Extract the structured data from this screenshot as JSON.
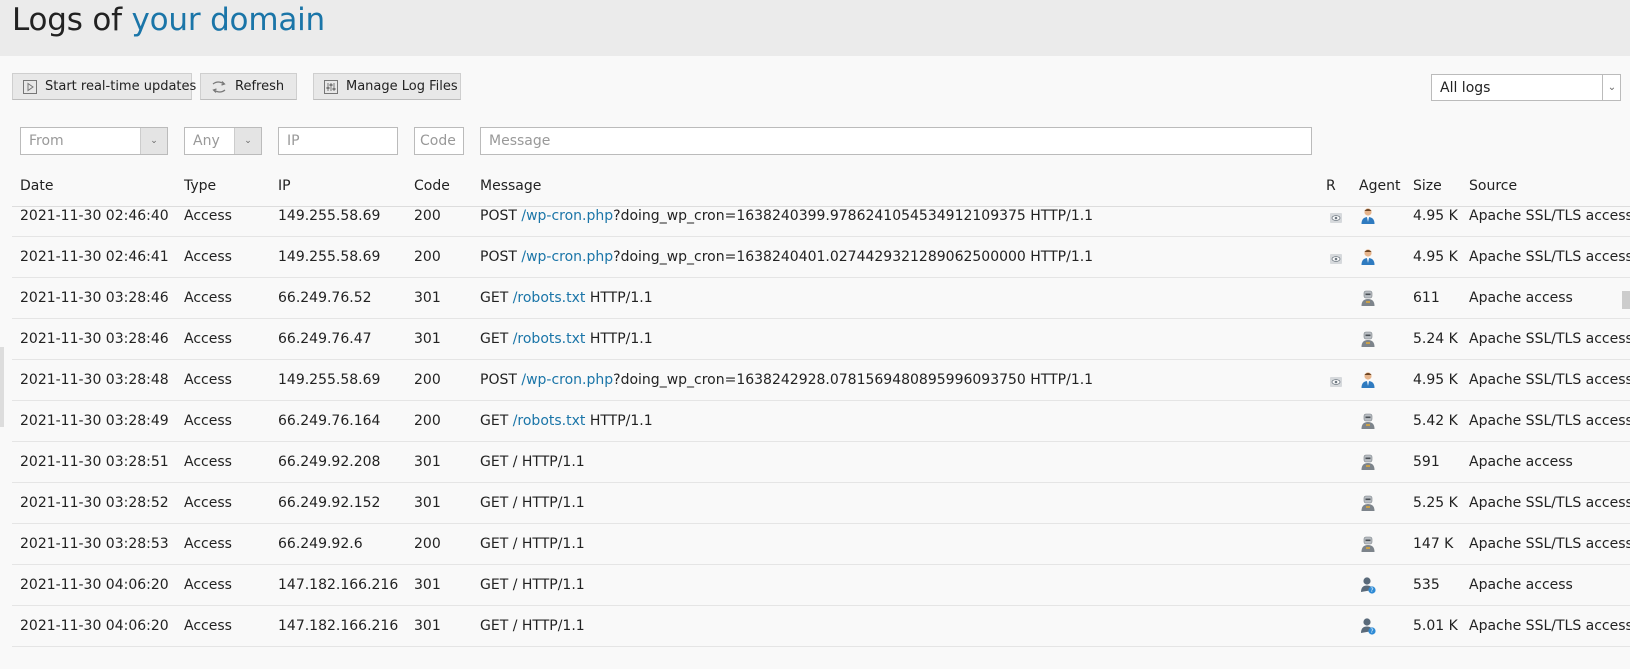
{
  "title": {
    "prefix": "Logs of",
    "domain": "your domain"
  },
  "toolbar": {
    "realtime_label": "Start real-time updates",
    "refresh_label": "Refresh",
    "manage_label": "Manage Log Files"
  },
  "log_select": {
    "value": "All logs"
  },
  "filters": {
    "from_placeholder": "From",
    "type_placeholder": "Any",
    "ip_placeholder": "IP",
    "code_placeholder": "Code",
    "message_placeholder": "Message"
  },
  "columns": {
    "date": "Date",
    "type": "Type",
    "ip": "IP",
    "code": "Code",
    "message": "Message",
    "r": "R",
    "agent": "Agent",
    "size": "Size",
    "source": "Source"
  },
  "rows": [
    {
      "date": "2021-11-30 02:46:40",
      "type": "Access",
      "ip": "149.255.58.69",
      "code": "200",
      "method": "POST",
      "path": "/wp-cron.php",
      "rest": "?doing_wp_cron=1638240399.9786241054534912109375 HTTP/1.1",
      "r": true,
      "agent": "user",
      "size": "4.95 K",
      "source": "Apache SSL/TLS access"
    },
    {
      "date": "2021-11-30 02:46:41",
      "type": "Access",
      "ip": "149.255.58.69",
      "code": "200",
      "method": "POST",
      "path": "/wp-cron.php",
      "rest": "?doing_wp_cron=1638240401.0274429321289062500000 HTTP/1.1",
      "r": true,
      "agent": "user",
      "size": "4.95 K",
      "source": "Apache SSL/TLS access"
    },
    {
      "date": "2021-11-30 03:28:46",
      "type": "Access",
      "ip": "66.249.76.52",
      "code": "301",
      "method": "GET",
      "path": "/robots.txt",
      "rest": " HTTP/1.1",
      "r": false,
      "agent": "bot",
      "size": "611",
      "source": "Apache access"
    },
    {
      "date": "2021-11-30 03:28:46",
      "type": "Access",
      "ip": "66.249.76.47",
      "code": "301",
      "method": "GET",
      "path": "/robots.txt",
      "rest": " HTTP/1.1",
      "r": false,
      "agent": "bot",
      "size": "5.24 K",
      "source": "Apache SSL/TLS access"
    },
    {
      "date": "2021-11-30 03:28:48",
      "type": "Access",
      "ip": "149.255.58.69",
      "code": "200",
      "method": "POST",
      "path": "/wp-cron.php",
      "rest": "?doing_wp_cron=1638242928.0781569480895996093750 HTTP/1.1",
      "r": true,
      "agent": "user",
      "size": "4.95 K",
      "source": "Apache SSL/TLS access"
    },
    {
      "date": "2021-11-30 03:28:49",
      "type": "Access",
      "ip": "66.249.76.164",
      "code": "200",
      "method": "GET",
      "path": "/robots.txt",
      "rest": " HTTP/1.1",
      "r": false,
      "agent": "bot",
      "size": "5.42 K",
      "source": "Apache SSL/TLS access"
    },
    {
      "date": "2021-11-30 03:28:51",
      "type": "Access",
      "ip": "66.249.92.208",
      "code": "301",
      "method": "GET",
      "path": "",
      "rest": "/ HTTP/1.1",
      "r": false,
      "agent": "bot",
      "size": "591",
      "source": "Apache access"
    },
    {
      "date": "2021-11-30 03:28:52",
      "type": "Access",
      "ip": "66.249.92.152",
      "code": "301",
      "method": "GET",
      "path": "",
      "rest": "/ HTTP/1.1",
      "r": false,
      "agent": "bot",
      "size": "5.25 K",
      "source": "Apache SSL/TLS access"
    },
    {
      "date": "2021-11-30 03:28:53",
      "type": "Access",
      "ip": "66.249.92.6",
      "code": "200",
      "method": "GET",
      "path": "",
      "rest": "/ HTTP/1.1",
      "r": false,
      "agent": "bot",
      "size": "147 K",
      "source": "Apache SSL/TLS access"
    },
    {
      "date": "2021-11-30 04:06:20",
      "type": "Access",
      "ip": "147.182.166.216",
      "code": "301",
      "method": "GET",
      "path": "",
      "rest": "/ HTTP/1.1",
      "r": false,
      "agent": "unknown",
      "size": "535",
      "source": "Apache access"
    },
    {
      "date": "2021-11-30 04:06:20",
      "type": "Access",
      "ip": "147.182.166.216",
      "code": "301",
      "method": "GET",
      "path": "",
      "rest": "/ HTTP/1.1",
      "r": false,
      "agent": "unknown",
      "size": "5.01 K",
      "source": "Apache SSL/TLS access"
    }
  ],
  "colors": {
    "link": "#1a75a8",
    "header_bg": "#ebebeb",
    "page_bg": "#f9f9f9"
  }
}
